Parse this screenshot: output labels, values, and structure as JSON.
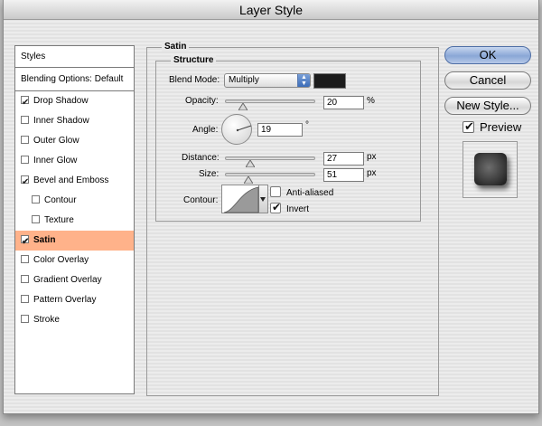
{
  "window": {
    "title": "Layer Style"
  },
  "styles_panel": {
    "header": "Styles",
    "blending_options": "Blending Options: Default",
    "items": [
      {
        "label": "Drop Shadow",
        "checked": true,
        "sub": false,
        "selected": false
      },
      {
        "label": "Inner Shadow",
        "checked": false,
        "sub": false,
        "selected": false
      },
      {
        "label": "Outer Glow",
        "checked": false,
        "sub": false,
        "selected": false
      },
      {
        "label": "Inner Glow",
        "checked": false,
        "sub": false,
        "selected": false
      },
      {
        "label": "Bevel and Emboss",
        "checked": true,
        "sub": false,
        "selected": false
      },
      {
        "label": "Contour",
        "checked": false,
        "sub": true,
        "selected": false
      },
      {
        "label": "Texture",
        "checked": false,
        "sub": true,
        "selected": false
      },
      {
        "label": "Satin",
        "checked": true,
        "sub": false,
        "selected": true
      },
      {
        "label": "Color Overlay",
        "checked": false,
        "sub": false,
        "selected": false
      },
      {
        "label": "Gradient Overlay",
        "checked": false,
        "sub": false,
        "selected": false
      },
      {
        "label": "Pattern Overlay",
        "checked": false,
        "sub": false,
        "selected": false
      },
      {
        "label": "Stroke",
        "checked": false,
        "sub": false,
        "selected": false
      }
    ]
  },
  "satin": {
    "group_title": "Satin",
    "structure_title": "Structure",
    "blend_mode_label": "Blend Mode:",
    "blend_mode_value": "Multiply",
    "color": "#1c1c1c",
    "opacity_label": "Opacity:",
    "opacity_value": "20",
    "opacity_unit": "%",
    "angle_label": "Angle:",
    "angle_value": "19",
    "angle_unit": "°",
    "distance_label": "Distance:",
    "distance_value": "27",
    "distance_unit": "px",
    "size_label": "Size:",
    "size_value": "51",
    "size_unit": "px",
    "contour_label": "Contour:",
    "anti_aliased_label": "Anti-aliased",
    "anti_aliased_checked": false,
    "invert_label": "Invert",
    "invert_checked": true
  },
  "buttons": {
    "ok": "OK",
    "cancel": "Cancel",
    "new_style": "New Style...",
    "preview_label": "Preview",
    "preview_checked": true
  }
}
